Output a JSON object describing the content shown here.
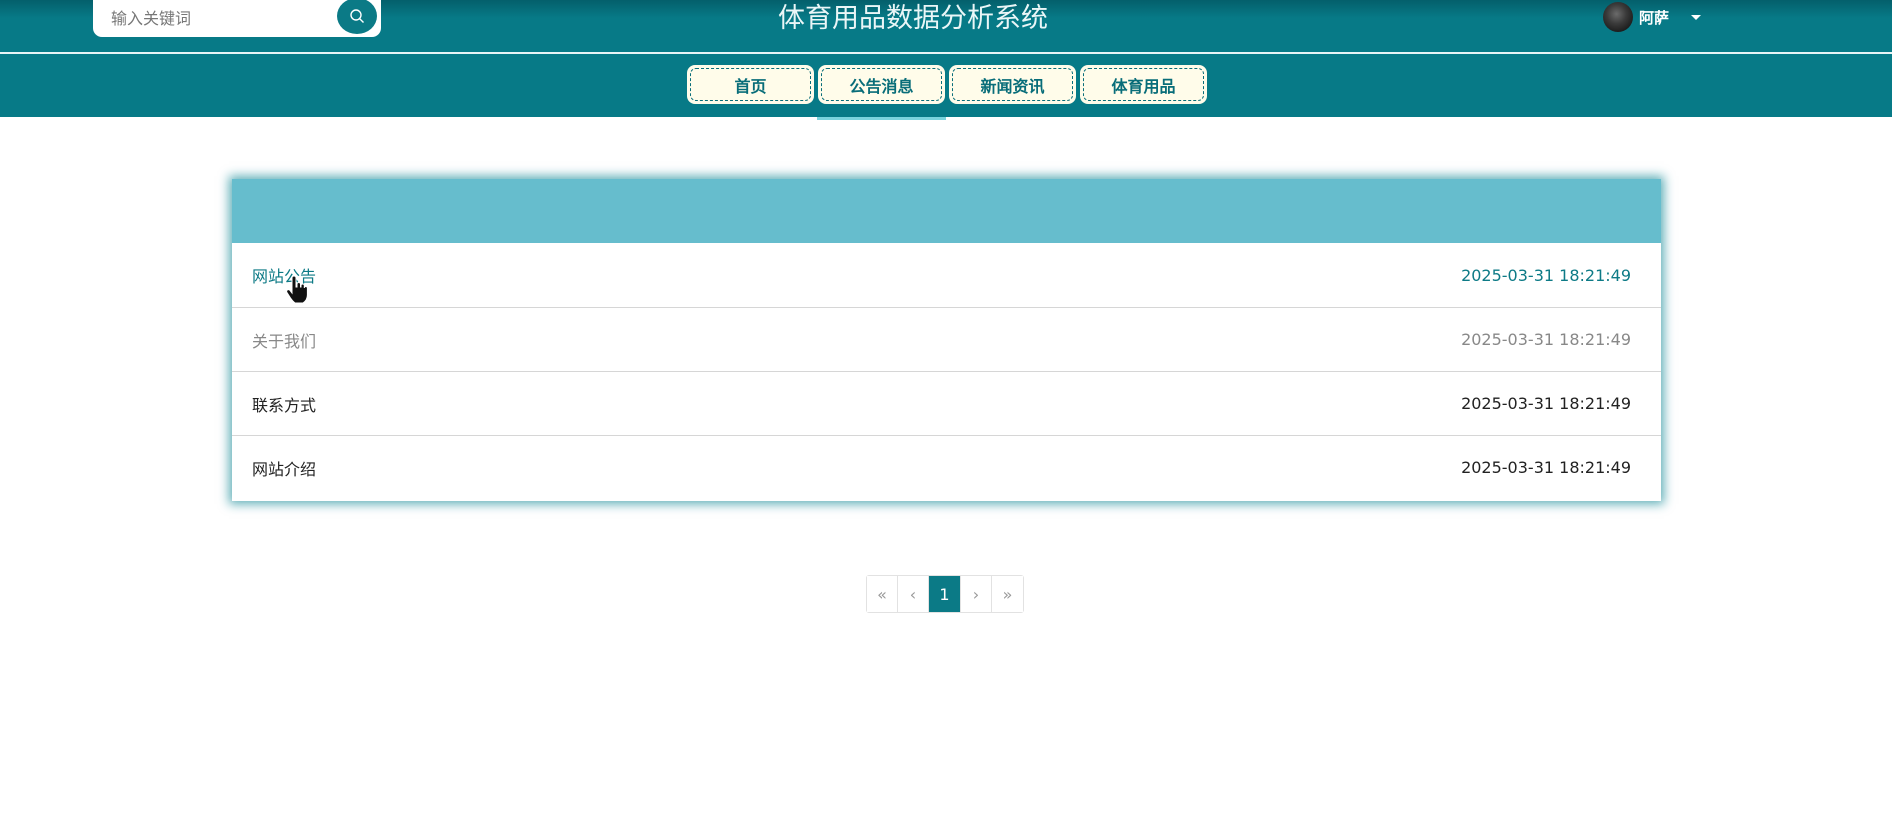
{
  "header": {
    "search_placeholder": "输入关键词",
    "title": "体育用品数据分析系统",
    "username": "阿萨"
  },
  "nav": {
    "items": [
      "首页",
      "公告消息",
      "新闻资讯",
      "体育用品"
    ],
    "active": "公告消息"
  },
  "notices": [
    {
      "title": "网站公告",
      "time": "2025-03-31 18:21:49"
    },
    {
      "title": "关于我们",
      "time": "2025-03-31 18:21:49"
    },
    {
      "title": "联系方式",
      "time": "2025-03-31 18:21:49"
    },
    {
      "title": "网站介绍",
      "time": "2025-03-31 18:21:49"
    }
  ],
  "pagination": {
    "first": "«",
    "prev": "‹",
    "current_page": "1",
    "next": "›",
    "last": "»"
  },
  "colors": {
    "primary": "#077a87",
    "nav_bg": "#fffcea",
    "panel_head": "#66bdcd"
  }
}
